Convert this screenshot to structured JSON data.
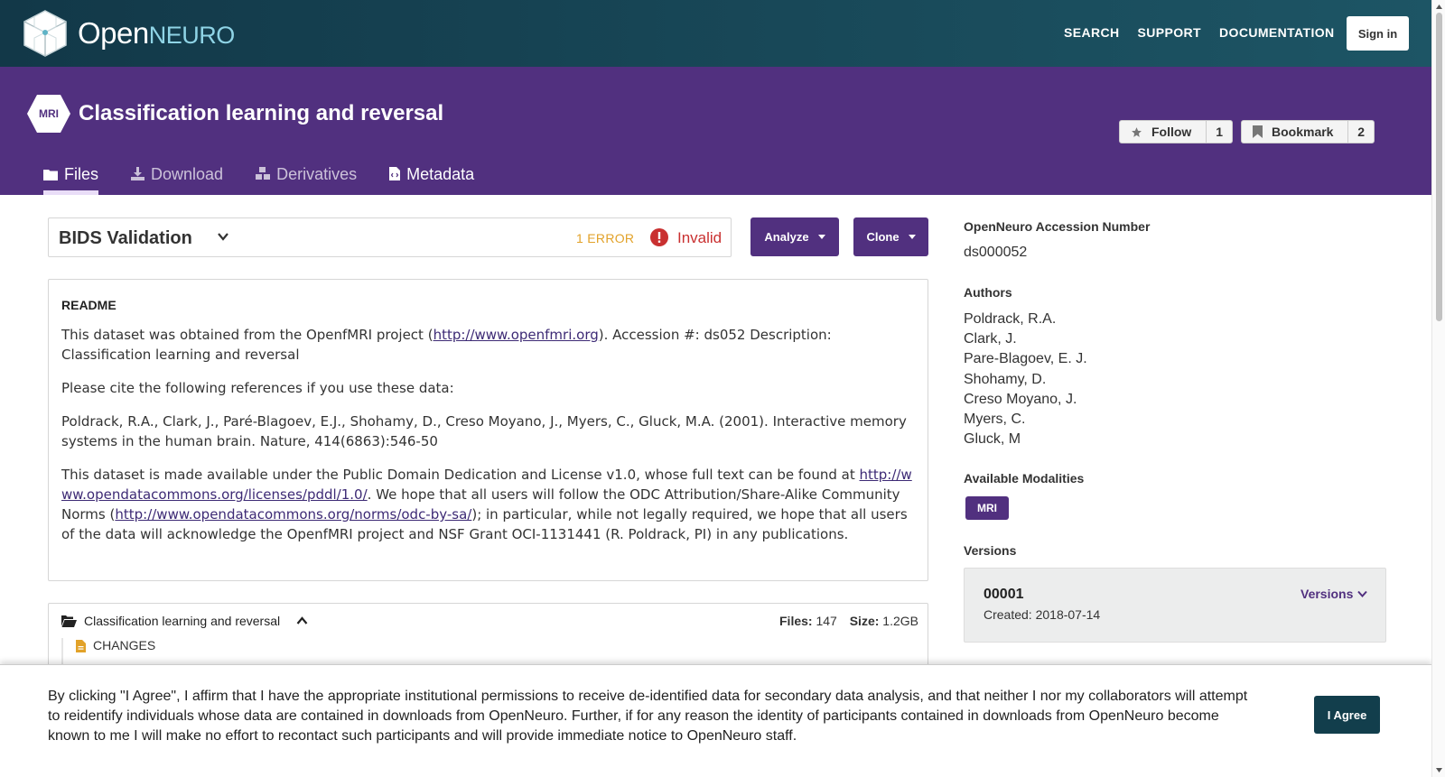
{
  "topnav": {
    "brand_open": "Open",
    "brand_neuro": "NEURO",
    "links": [
      "SEARCH",
      "SUPPORT",
      "DOCUMENTATION"
    ],
    "signin_label": "Sign in"
  },
  "dataset": {
    "modality_badge": "MRI",
    "title": "Classification learning and reversal",
    "follow": {
      "label": "Follow",
      "count": "1"
    },
    "bookmark": {
      "label": "Bookmark",
      "count": "2"
    },
    "tabs": [
      {
        "label": "Files",
        "icon": "folder-icon"
      },
      {
        "label": "Download",
        "icon": "download-icon"
      },
      {
        "label": "Derivatives",
        "icon": "cubes-icon"
      },
      {
        "label": "Metadata",
        "icon": "code-file-icon"
      }
    ]
  },
  "validation": {
    "title": "BIDS Validation",
    "error_count": "1 ERROR",
    "status": "Invalid",
    "analyze_label": "Analyze",
    "clone_label": "Clone"
  },
  "readme": {
    "heading": "README",
    "p1_a": "This dataset was obtained from the OpenfMRI project (",
    "p1_link": "http://www.openfmri.org",
    "p1_b": "). Accession #: ds052 Description: Classification learning and reversal",
    "p2": "Please cite the following references if you use these data:",
    "p3": "Poldrack, R.A., Clark, J., Paré-Blagoev, E.J., Shohamy, D., Creso Moyano, J., Myers, C., Gluck, M.A. (2001). Interactive memory systems in the human brain. Nature, 414(6863):546-50",
    "p4_a": "This dataset is made available under the Public Domain Dedication and License v1.0, whose full text can be found at ",
    "p4_link1": "http://www.opendatacommons.org/licenses/pddl/1.0/",
    "p4_b": ". We hope that all users will follow the ODC Attribution/Share-Alike Community Norms (",
    "p4_link2": "http://www.opendatacommons.org/norms/odc-by-sa/",
    "p4_c": "); in particular, while not legally required, we hope that all users of the data will acknowledge the OpenfMRI project and NSF Grant OCI-1131441 (R. Poldrack, PI) in any publications."
  },
  "files": {
    "root_name": "Classification learning and reversal",
    "files_label": "Files:",
    "files_count": "147",
    "size_label": "Size:",
    "size_value": "1.2GB",
    "children": [
      "CHANGES"
    ]
  },
  "sidebar": {
    "accession_label": "OpenNeuro Accession Number",
    "accession_value": "ds000052",
    "authors_label": "Authors",
    "authors": [
      "Poldrack, R.A.",
      "Clark, J.",
      "Pare-Blagoev, E. J.",
      "Shohamy, D.",
      "Creso Moyano, J.",
      "Myers, C.",
      "Gluck, M"
    ],
    "modalities_label": "Available Modalities",
    "modalities": [
      "MRI"
    ],
    "versions_label": "Versions",
    "version_number": "00001",
    "version_created": "Created: 2018-07-14",
    "versions_link": "Versions"
  },
  "consent": {
    "text": "By clicking \"I Agree\", I affirm that I have the appropriate institutional permissions to receive de-identified data for secondary data analysis, and that neither I nor my collaborators will attempt to reidentify individuals whose data are contained in downloads from OpenNeuro. Further, if for any reason the identity of participants contained in downloads from OpenNeuro become known to me I will make no effort to recontact such participants and will provide immediate notice to OpenNeuro staff.",
    "agree_label": "I Agree"
  },
  "colors": {
    "nav_bg": "#123848",
    "header_purple": "#51307f",
    "error_orange": "#e2a229",
    "invalid_red": "#c93030"
  }
}
